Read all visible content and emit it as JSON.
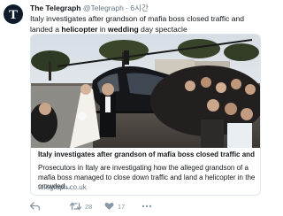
{
  "tweet": {
    "author_name": "The Telegraph",
    "handle": "@Telegraph",
    "separator": "·",
    "time": "6시간",
    "text_line1": "Italy investigates after grandson of mafia boss closed traffic and landed a",
    "text_bold1": "helicopter",
    "text_mid": " in ",
    "text_bold2": "wedding",
    "text_end": " day spectacle"
  },
  "card": {
    "title": "Italy investigates after grandson of mafia boss closed traffic and land...",
    "description": "Prosecutors in Italy are investigating how the alleged grandson of a mafia boss managed to close down traffic and land a helicopter in the crowded...",
    "domain": "telegraph.co.uk"
  },
  "actions": {
    "reply_icon": "reply-icon",
    "retweet_icon": "retweet-icon",
    "retweet_count": "28",
    "like_icon": "heart-icon",
    "like_count": "17",
    "more_icon": "more-icon"
  },
  "colors": {
    "text": "#14171a",
    "secondary": "#657786",
    "border": "#e1e8ed",
    "icon": "#8899a6",
    "avatar_bg": "#0f1a2b"
  }
}
